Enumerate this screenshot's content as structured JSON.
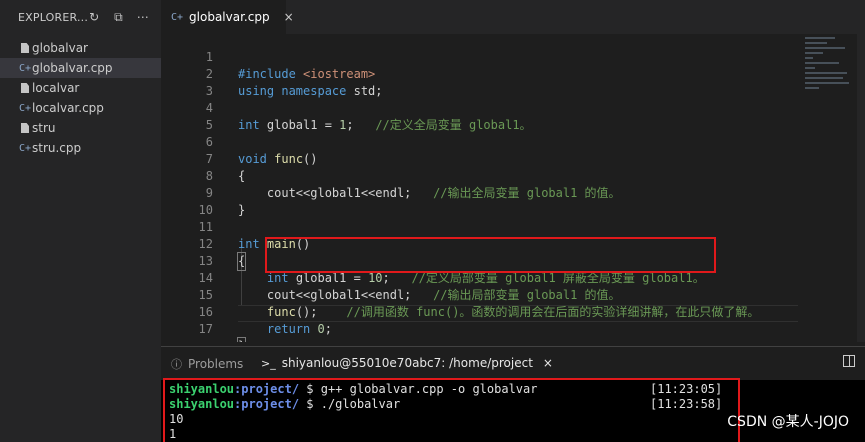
{
  "sidebar": {
    "title": "EXPLORER...",
    "files": [
      {
        "name": "globalvar",
        "type": "file"
      },
      {
        "name": "globalvar.cpp",
        "type": "cpp",
        "active": true
      },
      {
        "name": "localvar",
        "type": "file"
      },
      {
        "name": "localvar.cpp",
        "type": "cpp"
      },
      {
        "name": "stru",
        "type": "file"
      },
      {
        "name": "stru.cpp",
        "type": "cpp"
      }
    ]
  },
  "tab": {
    "label": "globalvar.cpp",
    "icon": "cpp-file-icon",
    "close": "×"
  },
  "editor": {
    "line_numbers": [
      "1",
      "2",
      "3",
      "4",
      "5",
      "6",
      "7",
      "8",
      "9",
      "10",
      "11",
      "12",
      "13",
      "14",
      "15",
      "16",
      "17"
    ],
    "lines": [
      "#include <iostream>",
      "using namespace std;",
      "",
      "int global1 = 1;   //定义全局变量 global1。",
      "",
      "void func()",
      "{",
      "    cout<<global1<<endl;   //输出全局变量 global1 的值。",
      "}",
      "",
      "int main()",
      "{",
      "    int global1 = 10;   //定义局部变量 global1 屏蔽全局变量 global1。",
      "    cout<<global1<<endl;   //输出局部变量 global1 的值。",
      "    func();    //调用函数 func()。函数的调用会在后面的实验详细讲解，在此只做了解。",
      "    return 0;",
      "}"
    ]
  },
  "panel": {
    "problems_label": "Problems",
    "terminal_label": "shiyanlou@55010e70abc7: /home/project",
    "terminal_icon": "terminal-icon",
    "close": "×"
  },
  "terminal": {
    "lines": [
      {
        "user": "shiyanlou",
        "path": ":project/",
        "cmd": " $ g++ globalvar.cpp -o globalvar",
        "time": "[11:23:05]"
      },
      {
        "user": "shiyanlou",
        "path": ":project/",
        "cmd": " $ ./globalvar",
        "time": "[11:23:58]"
      },
      {
        "user": "",
        "path": "",
        "cmd": "10",
        "time": ""
      },
      {
        "user": "",
        "path": "",
        "cmd": "1",
        "time": ""
      }
    ]
  },
  "watermark": "CSDN @某人-JOJO",
  "colors": {
    "highlight_box": "#e0191b",
    "keyword": "#569cd6",
    "comment": "#6a9955",
    "number": "#b5cea8"
  }
}
